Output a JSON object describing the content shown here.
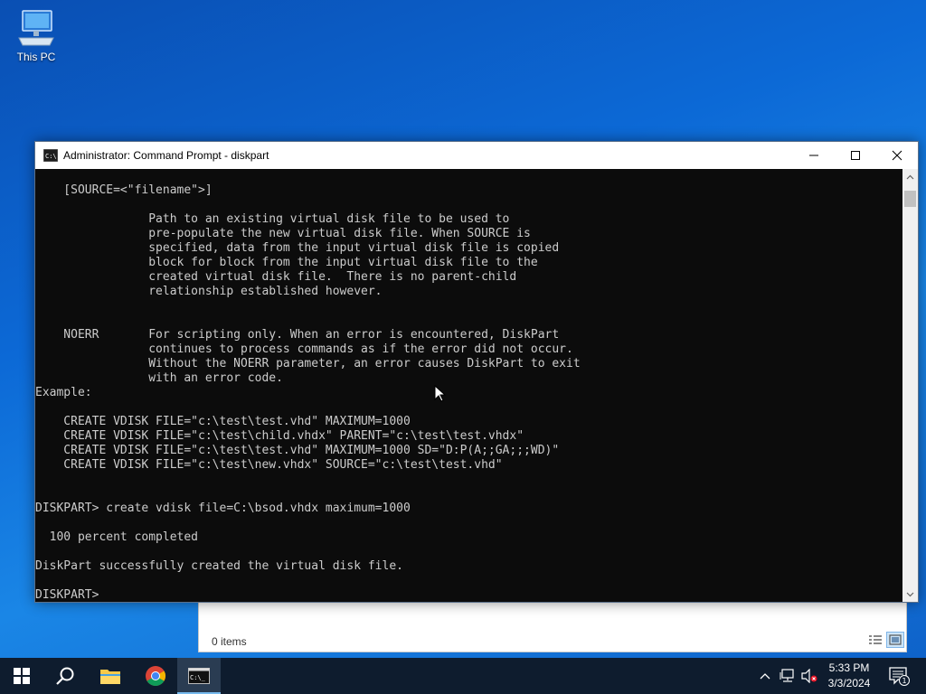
{
  "desktop": {
    "icons": [
      {
        "label": "This PC",
        "icon": "computer-icon"
      }
    ]
  },
  "explorer": {
    "status": "0 items"
  },
  "cmd": {
    "title": "Administrator: Command Prompt - diskpart",
    "lines": [
      "    [SOURCE=<\"filename\">]",
      "",
      "                Path to an existing virtual disk file to be used to",
      "                pre-populate the new virtual disk file. When SOURCE is",
      "                specified, data from the input virtual disk file is copied",
      "                block for block from the input virtual disk file to the",
      "                created virtual disk file.  There is no parent-child",
      "                relationship established however.",
      "",
      "",
      "    NOERR       For scripting only. When an error is encountered, DiskPart",
      "                continues to process commands as if the error did not occur.",
      "                Without the NOERR parameter, an error causes DiskPart to exit",
      "                with an error code.",
      "Example:",
      "",
      "    CREATE VDISK FILE=\"c:\\test\\test.vhd\" MAXIMUM=1000",
      "    CREATE VDISK FILE=\"c:\\test\\child.vhdx\" PARENT=\"c:\\test\\test.vhdx\"",
      "    CREATE VDISK FILE=\"c:\\test\\test.vhd\" MAXIMUM=1000 SD=\"D:P(A;;GA;;;WD)\"",
      "    CREATE VDISK FILE=\"c:\\test\\new.vhdx\" SOURCE=\"c:\\test\\test.vhd\"",
      "",
      "",
      "DISKPART> create vdisk file=C:\\bsod.vhdx maximum=1000",
      "",
      "  100 percent completed",
      "",
      "DiskPart successfully created the virtual disk file.",
      "",
      "DISKPART> "
    ]
  },
  "taskbar": {
    "items": [
      "start-icon",
      "search-icon",
      "file-explorer-icon",
      "chrome-icon",
      "command-prompt-icon"
    ],
    "clock_time": "5:33 PM",
    "clock_date": "3/3/2024",
    "notification_count": "1"
  },
  "colors": {
    "console_bg": "#0c0c0c",
    "console_text": "#cccccc",
    "taskbar_bg": "#0e1c2e",
    "accent": "#76b9ed"
  }
}
